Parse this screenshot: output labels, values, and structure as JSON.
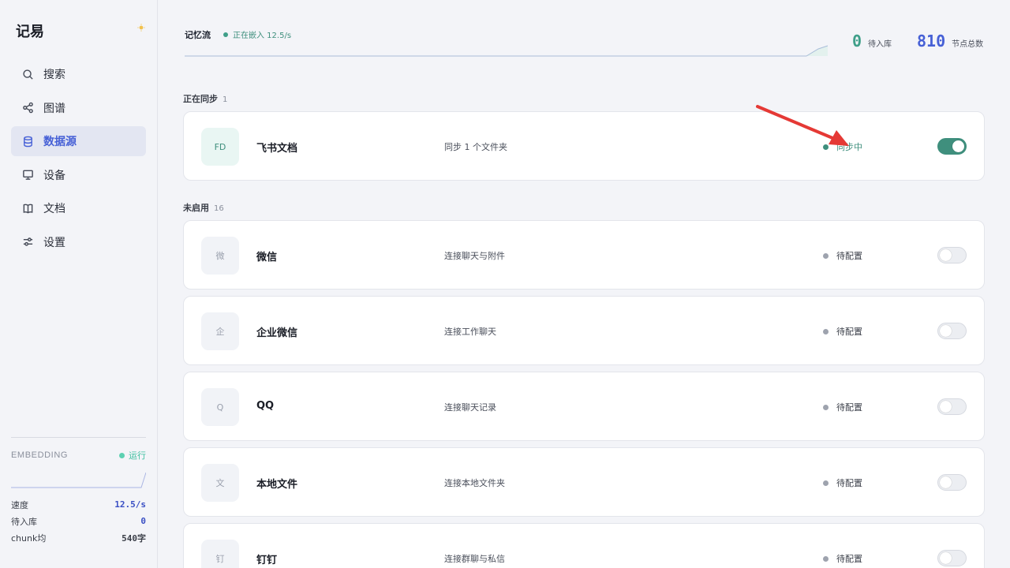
{
  "app": {
    "brand": "记易"
  },
  "sidebar": {
    "items": [
      {
        "label": "搜索",
        "icon": "search-icon"
      },
      {
        "label": "图谱",
        "icon": "share-graph-icon"
      },
      {
        "label": "数据源",
        "icon": "database-icon",
        "active": true
      },
      {
        "label": "设备",
        "icon": "monitor-icon"
      },
      {
        "label": "文档",
        "icon": "book-icon"
      },
      {
        "label": "设置",
        "icon": "sliders-icon"
      }
    ],
    "embedding": {
      "title": "EMBEDDING",
      "status": "运行",
      "stats": [
        {
          "label": "速度",
          "value": "12.5/s"
        },
        {
          "label": "待入库",
          "value": "0"
        },
        {
          "label": "chunk均",
          "value": "540字"
        }
      ]
    }
  },
  "header": {
    "flow_title": "记忆流",
    "flow_status": "正在嵌入 12.5/s",
    "pending_value": "0",
    "pending_label": "待入库",
    "nodes_value": "810",
    "nodes_label": "节点总数"
  },
  "sections": {
    "syncing": {
      "label": "正在同步",
      "count": "1"
    },
    "disabled": {
      "label": "未启用",
      "count": "16"
    }
  },
  "sources": [
    {
      "badge": "FD",
      "name": "飞书文档",
      "desc": "同步 1 个文件夹",
      "status": "同步中",
      "enabled": true
    },
    {
      "badge": "微",
      "name": "微信",
      "desc": "连接聊天与附件",
      "status": "待配置",
      "enabled": false
    },
    {
      "badge": "企",
      "name": "企业微信",
      "desc": "连接工作聊天",
      "status": "待配置",
      "enabled": false
    },
    {
      "badge": "Q",
      "name": "QQ",
      "desc": "连接聊天记录",
      "status": "待配置",
      "enabled": false
    },
    {
      "badge": "文",
      "name": "本地文件",
      "desc": "连接本地文件夹",
      "status": "待配置",
      "enabled": false
    },
    {
      "badge": "钉",
      "name": "钉钉",
      "desc": "连接群聊与私信",
      "status": "待配置",
      "enabled": false
    }
  ],
  "colors": {
    "accent_blue": "#4660d6",
    "accent_green": "#3f8f7d",
    "annotation_red": "#e53935"
  }
}
